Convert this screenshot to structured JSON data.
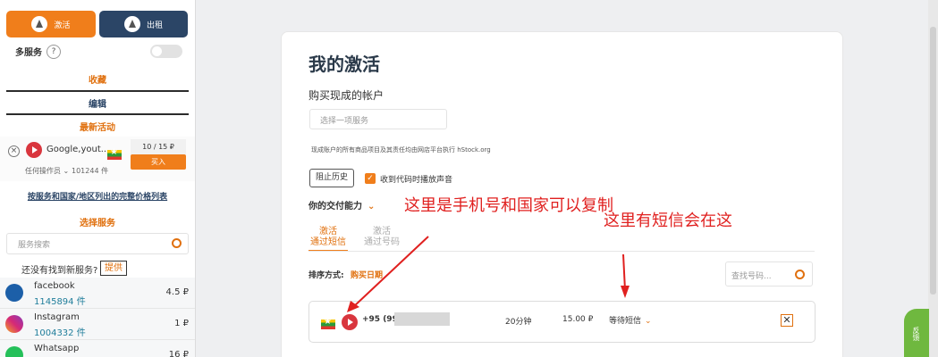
{
  "sidebar": {
    "activate_label": "激活",
    "rent_label": "出租",
    "multi_service_label": "多服务",
    "help_mark": "?",
    "favorites": "收藏",
    "edit": "编辑",
    "latest_activity": "最新活动",
    "activity": {
      "service": "Google,yout...",
      "price": "10 / 15 ₽",
      "buy": "买入",
      "operator": "任何操作员",
      "count": "101244 件"
    },
    "full_price_link": "按服务和国家/地区列出的完整价格列表",
    "select_service": "选择服务",
    "search_placeholder": "服务搜索",
    "not_found": "还没有找到新服务?",
    "provide": "提供",
    "services": [
      {
        "name": "facebook",
        "count": "1145894 件",
        "price": "4.5 ₽"
      },
      {
        "name": "Instagram",
        "count": "1004332 件",
        "price": "1 ₽"
      },
      {
        "name": "Whatsapp",
        "count": "",
        "price": "16 ₽"
      }
    ]
  },
  "main": {
    "title": "我的激活",
    "buy_label": "购买现成的帐户",
    "select_placeholder": "选择一项服务",
    "note": "现成账户的所有商品项目及其责任均由网店平台执行 hStock.org",
    "block_history": "阻止历史",
    "sound_label": "收到代码时播放声音",
    "delivery": "你的交付能力",
    "tab_active": "激活\n通过短信",
    "tab_inactive": "激活\n通过号码",
    "sort_label": "排序方式:",
    "sort_value": "购买日期",
    "search_placeholder": "查找号码...",
    "row": {
      "phone": "+95 (99",
      "time": "20分钟",
      "price": "15.00 ₽",
      "status": "等待短信"
    }
  },
  "annotations": {
    "copy_note": "这里是手机号和国家可以复制",
    "sms_note": "这里有短信会在这"
  },
  "feedback_tab": "反馈"
}
